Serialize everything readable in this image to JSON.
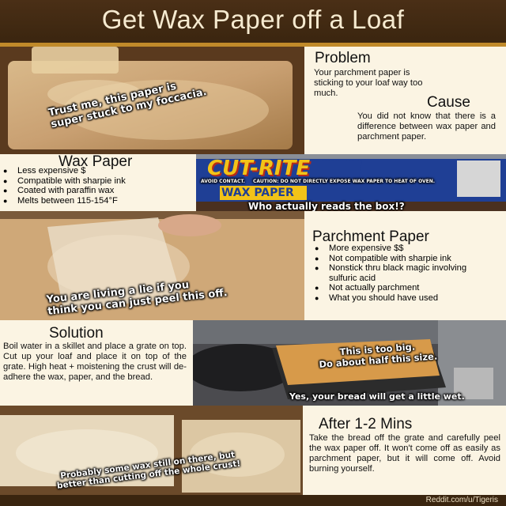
{
  "title": "Get Wax Paper off a Loaf",
  "problem": {
    "heading": "Problem",
    "text": "Your parchment paper is sticking to your loaf way too much."
  },
  "cause": {
    "heading": "Cause",
    "text": "You did not know that there is a difference between wax paper and parchment paper."
  },
  "captions": {
    "focaccia_line1": "Trust me, this paper is",
    "focaccia_line2": "super stuck to my foccacia.",
    "box": "Who actually reads the box!?",
    "peel_line1": "You are living a lie if you",
    "peel_line2": "think you can just peel this off.",
    "grate_line1": "This is too big.",
    "grate_line2": "Do about half this size.",
    "wet": "Yes, your bread will get a little wet.",
    "wax_line1": "Probably some wax still on there, but",
    "wax_line2": "better than cutting off the whole crust!"
  },
  "box_label": {
    "brand": "CUT-RITE",
    "product": "WAX PAPER",
    "warning": "CAUTION: DO NOT DIRECTLY EXPOSE WAX PAPER TO HEAT OF OVEN.",
    "contact": "AVOID CONTACT."
  },
  "wax_paper": {
    "heading": "Wax Paper",
    "bullets": [
      "Less expensive $",
      "Compatible with sharpie ink",
      "Coated with paraffin wax",
      "Melts between 115-154°F"
    ]
  },
  "parchment_paper": {
    "heading": "Parchment Paper",
    "bullets": [
      "More expensive $$",
      "Not compatible with sharpie ink",
      "Nonstick thru black magic involving sulfuric acid",
      "Not actually parchment",
      "What you should have used"
    ]
  },
  "solution": {
    "heading": "Solution",
    "text": "Boil water in a skillet and place a grate on top. Cut up your loaf and place it on top of the grate. High heat + moistening the crust will de-adhere the wax, paper, and the bread."
  },
  "after": {
    "heading": "After 1-2 Mins",
    "text": "Take the bread off the grate and carefully peel the wax paper off. It won't come off as easily as parchment paper, but it will come off. Avoid burning yourself."
  },
  "footer": "Reddit.com/u/Tigeris",
  "colors": {
    "panel": "#fbf4e3",
    "header": "#3a250f",
    "accent": "#c08a2a",
    "box_blue": "#1f3f95",
    "box_yellow": "#f2c318"
  }
}
